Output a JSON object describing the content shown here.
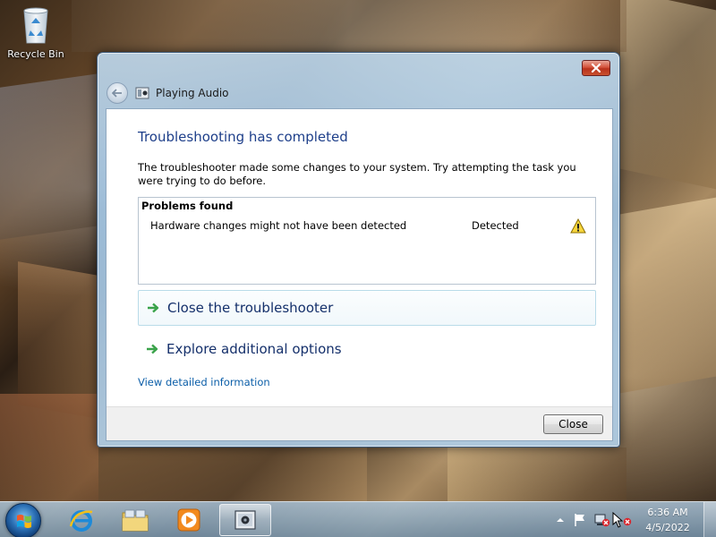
{
  "desktop": {
    "recycle_bin_label": "Recycle Bin"
  },
  "window": {
    "title": "Playing Audio",
    "heading": "Troubleshooting has completed",
    "description": "The troubleshooter made some changes to your system. Try attempting the task you were trying to do before.",
    "problems": {
      "title": "Problems found",
      "rows": [
        {
          "name": "Hardware changes might not have been detected",
          "status": "Detected",
          "icon": "warning-icon"
        }
      ]
    },
    "commands": [
      {
        "label": "Close the troubleshooter",
        "icon": "green-arrow-icon"
      },
      {
        "label": "Explore additional options",
        "icon": "green-arrow-icon"
      }
    ],
    "detail_link": "View detailed information",
    "close_button": "Close"
  },
  "taskbar": {
    "items": [
      "start-orb",
      "internet-explorer-icon",
      "windows-explorer-icon",
      "media-player-icon",
      "troubleshooter-icon"
    ],
    "active_item": "troubleshooter-icon",
    "clock": {
      "time": "6:36 AM",
      "date": "4/5/2022"
    }
  },
  "colors": {
    "heading": "#1e3f8a",
    "command": "#15306b",
    "link": "#0b5ea8",
    "close_x": "#c9502e"
  }
}
